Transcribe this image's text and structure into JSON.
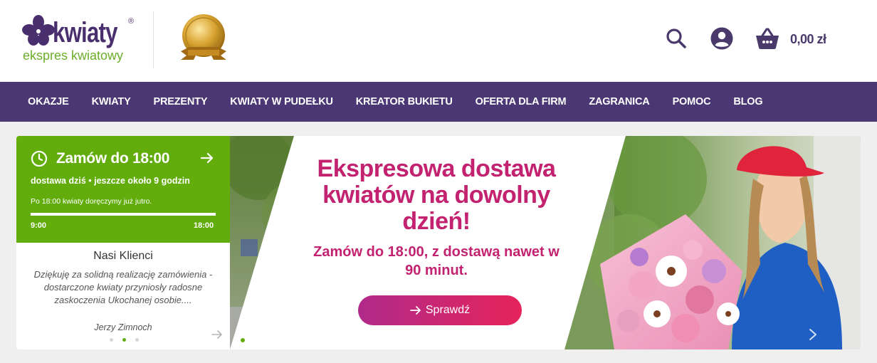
{
  "header": {
    "logo_word": "kwiaty",
    "logo_reg": "®",
    "logo_tagline": "ekspres kwiatowy",
    "cart_total": "0,00 zł"
  },
  "nav": {
    "items": [
      "OKAZJE",
      "KWIATY",
      "PREZENTY",
      "KWIATY W PUDEŁKU",
      "KREATOR BUKIETU",
      "OFERTA DLA FIRM",
      "ZAGRANICA",
      "POMOC",
      "BLOG"
    ]
  },
  "delivery": {
    "title": "Zamów do 18:00",
    "subtitle": "dostawa dziś • jeszcze około 9 godzin",
    "note": "Po 18:00 kwiaty doręczymy już jutro.",
    "time_start": "9:00",
    "time_end": "18:00",
    "progress": 1.0
  },
  "testimonial": {
    "heading": "Nasi Klienci",
    "quote": "Dziękuję za solidną realizację zamówienia - dostarczone kwiaty przyniosły radosne zaskoczenia Ukochanej osobie....",
    "author": "Jerzy Zimnoch",
    "slide_count": 3,
    "active_slide": 2
  },
  "banner": {
    "headline": "Ekspresowa dostawa kwiatów na dowolny dzień!",
    "subheadline": "Zamów do  18:00, z dostawą nawet w 90 minut.",
    "cta_label": "Sprawdź",
    "slide_count": 2,
    "active_slide": 1
  },
  "colors": {
    "brand_purple": "#4a3773",
    "brand_green": "#62ad0c",
    "banner_pink": "#c2226f",
    "cta_gradient_start": "#b02a8a",
    "cta_gradient_end": "#e5245a"
  },
  "icons": [
    "search-icon",
    "account-icon",
    "cart-icon",
    "clock-icon",
    "arrow-right-icon",
    "flower-logo-icon",
    "award-badge-icon"
  ]
}
